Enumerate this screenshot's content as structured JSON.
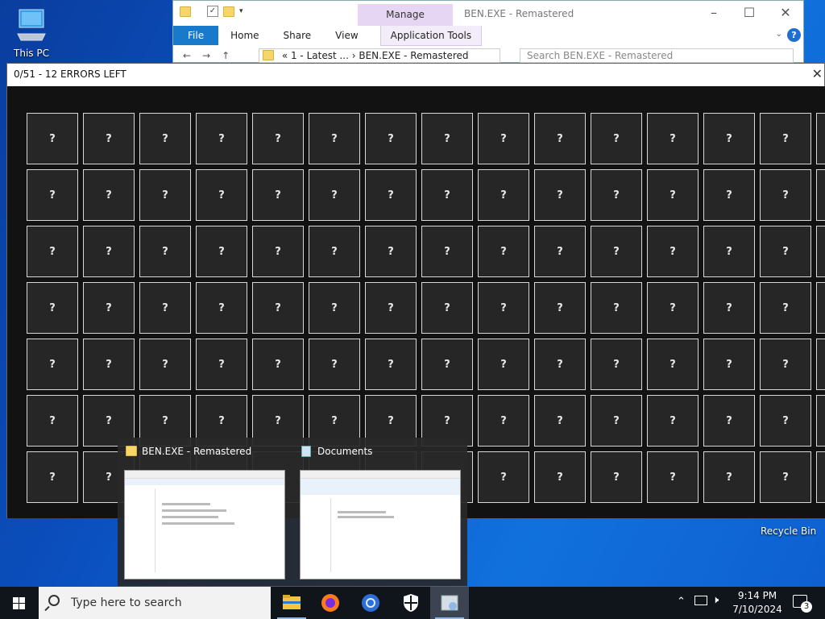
{
  "desktop": {
    "this_pc": "This PC",
    "recycle_bin": "Recycle Bin"
  },
  "explorer": {
    "title": "BEN.EXE - Remastered",
    "context_tab": "Manage",
    "tabs": [
      "File",
      "Home",
      "Share",
      "View"
    ],
    "app_tools": "Application Tools",
    "breadcrumb": "«  1 - Latest ...  ›  BEN.EXE - Remastered",
    "search_placeholder": "Search BEN.EXE - Remastered"
  },
  "game": {
    "title": "0/51 - 12 ERRORS LEFT",
    "cell_symbol": "?",
    "columns": 15,
    "rows": 7
  },
  "preview": {
    "items": [
      {
        "title": "BEN.EXE - Remastered"
      },
      {
        "title": "Documents"
      }
    ]
  },
  "taskbar": {
    "search_placeholder": "Type here to search",
    "time": "9:14 PM",
    "date": "7/10/2024",
    "notification_count": "3",
    "apps": [
      "file-explorer-icon",
      "firefox-icon",
      "chrome-icon",
      "security-icon",
      "ben-exe-icon"
    ]
  }
}
